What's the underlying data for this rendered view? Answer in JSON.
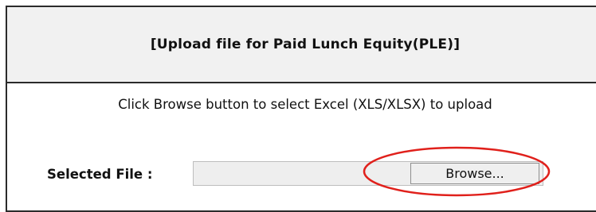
{
  "header": {
    "title": "[Upload file for Paid Lunch Equity(PLE)]"
  },
  "instruction": "Click Browse button to select Excel (XLS/XLSX) to upload",
  "file": {
    "label": "Selected File :",
    "value": "",
    "browse_label": "Browse..."
  },
  "annotation": {
    "color": "#e0201b"
  }
}
